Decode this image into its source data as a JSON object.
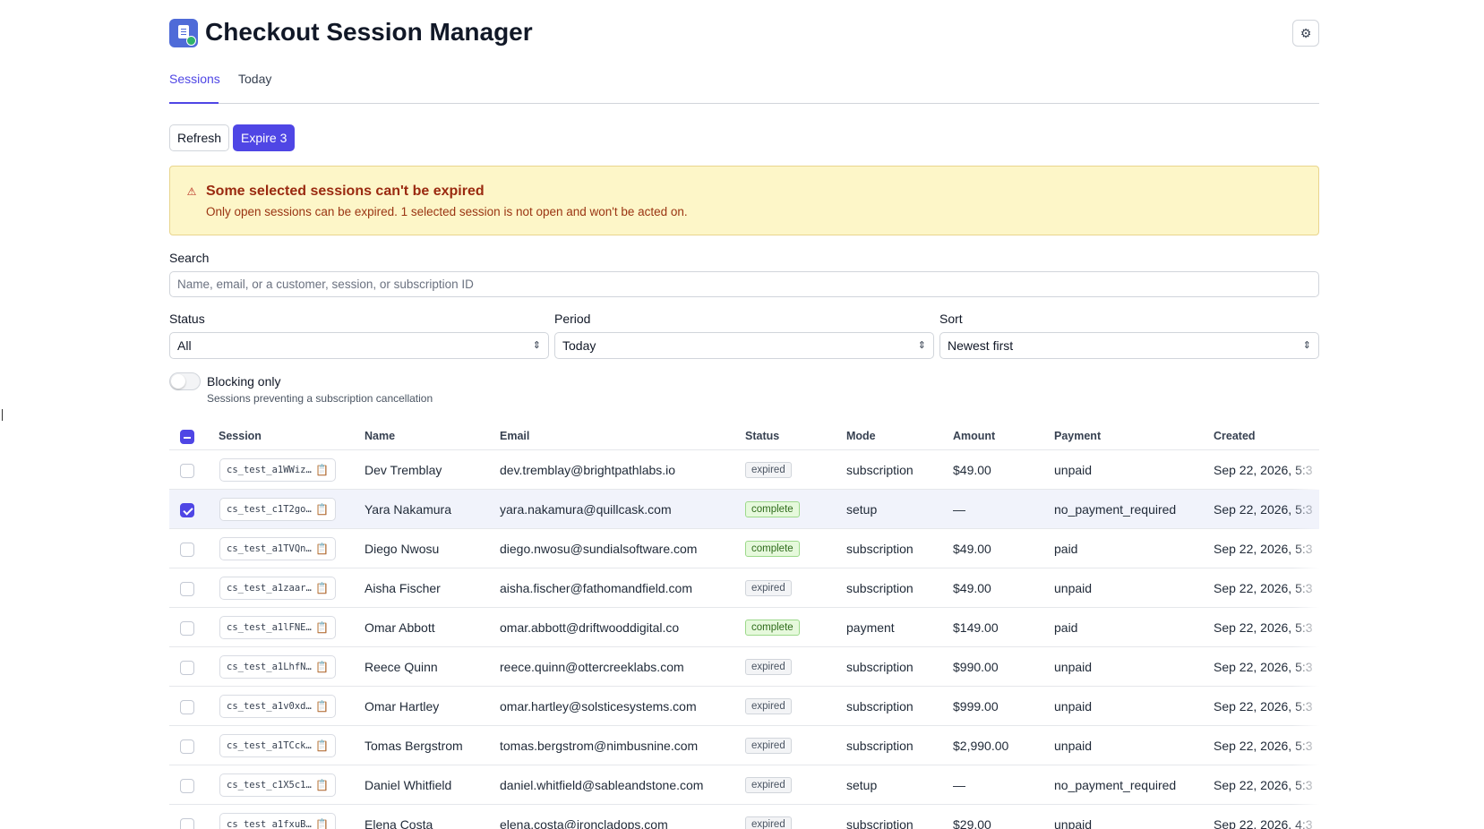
{
  "app": {
    "title": "Checkout Session Manager",
    "icon": "receipt-check-icon",
    "settings_icon": "gear-icon"
  },
  "tabs": [
    {
      "label": "Sessions",
      "active": true
    },
    {
      "label": "Today",
      "active": false
    }
  ],
  "actions": {
    "refresh_label": "Refresh",
    "expire_label": "Expire 3"
  },
  "alert": {
    "icon": "warning-icon",
    "title": "Some selected sessions can't be expired",
    "message": "Only open sessions can be expired. 1 selected session is not open and won't be acted on."
  },
  "search": {
    "label": "Search",
    "placeholder": "Name, email, or a customer, session, or subscription ID",
    "value": ""
  },
  "filters": {
    "status": {
      "label": "Status",
      "value": "All"
    },
    "period": {
      "label": "Period",
      "value": "Today"
    },
    "sort": {
      "label": "Sort",
      "value": "Newest first"
    }
  },
  "blocking_toggle": {
    "label": "Blocking only",
    "help": "Sessions preventing a subscription cancellation",
    "on": false
  },
  "table": {
    "columns": [
      "Session",
      "Name",
      "Email",
      "Status",
      "Mode",
      "Amount",
      "Payment",
      "Created"
    ],
    "header_checkbox": "indeterminate",
    "rows": [
      {
        "session": "cs_test_a1WWiz…",
        "name": "Dev Tremblay",
        "email": "dev.tremblay@brightpathlabs.io",
        "status": "expired",
        "mode": "subscription",
        "amount": "$49.00",
        "payment": "unpaid",
        "created": "Sep 22, 2026, 5:3",
        "checked": false
      },
      {
        "session": "cs_test_c1T2go…",
        "name": "Yara Nakamura",
        "email": "yara.nakamura@quillcask.com",
        "status": "complete",
        "mode": "setup",
        "amount": "—",
        "payment": "no_payment_required",
        "created": "Sep 22, 2026, 5:3",
        "checked": true
      },
      {
        "session": "cs_test_a1TVQn…",
        "name": "Diego Nwosu",
        "email": "diego.nwosu@sundialsoftware.com",
        "status": "complete",
        "mode": "subscription",
        "amount": "$49.00",
        "payment": "paid",
        "created": "Sep 22, 2026, 5:3",
        "checked": false
      },
      {
        "session": "cs_test_a1zaar…",
        "name": "Aisha Fischer",
        "email": "aisha.fischer@fathomandfield.com",
        "status": "expired",
        "mode": "subscription",
        "amount": "$49.00",
        "payment": "unpaid",
        "created": "Sep 22, 2026, 5:3",
        "checked": false
      },
      {
        "session": "cs_test_a1lFNE…",
        "name": "Omar Abbott",
        "email": "omar.abbott@driftwooddigital.co",
        "status": "complete",
        "mode": "payment",
        "amount": "$149.00",
        "payment": "paid",
        "created": "Sep 22, 2026, 5:3",
        "checked": false
      },
      {
        "session": "cs_test_a1LhfN…",
        "name": "Reece Quinn",
        "email": "reece.quinn@ottercreeklabs.com",
        "status": "expired",
        "mode": "subscription",
        "amount": "$990.00",
        "payment": "unpaid",
        "created": "Sep 22, 2026, 5:3",
        "checked": false
      },
      {
        "session": "cs_test_a1v0xd…",
        "name": "Omar Hartley",
        "email": "omar.hartley@solsticesystems.com",
        "status": "expired",
        "mode": "subscription",
        "amount": "$999.00",
        "payment": "unpaid",
        "created": "Sep 22, 2026, 5:3",
        "checked": false
      },
      {
        "session": "cs_test_a1TCck…",
        "name": "Tomas Bergstrom",
        "email": "tomas.bergstrom@nimbusnine.com",
        "status": "expired",
        "mode": "subscription",
        "amount": "$2,990.00",
        "payment": "unpaid",
        "created": "Sep 22, 2026, 5:3",
        "checked": false
      },
      {
        "session": "cs_test_c1X5c1…",
        "name": "Daniel Whitfield",
        "email": "daniel.whitfield@sableandstone.com",
        "status": "expired",
        "mode": "setup",
        "amount": "—",
        "payment": "no_payment_required",
        "created": "Sep 22, 2026, 5:3",
        "checked": false
      },
      {
        "session": "cs_test_a1fxuB…",
        "name": "Elena Costa",
        "email": "elena.costa@ironcladops.com",
        "status": "expired",
        "mode": "subscription",
        "amount": "$29.00",
        "payment": "unpaid",
        "created": "Sep 22, 2026, 4:3",
        "checked": false
      }
    ]
  },
  "colors": {
    "accent": "#4f46e5",
    "alert_bg": "#fdf6c8",
    "alert_text": "#9a2a10",
    "complete_badge": "#e6f9dc",
    "expired_badge": "#f3f4f6"
  }
}
